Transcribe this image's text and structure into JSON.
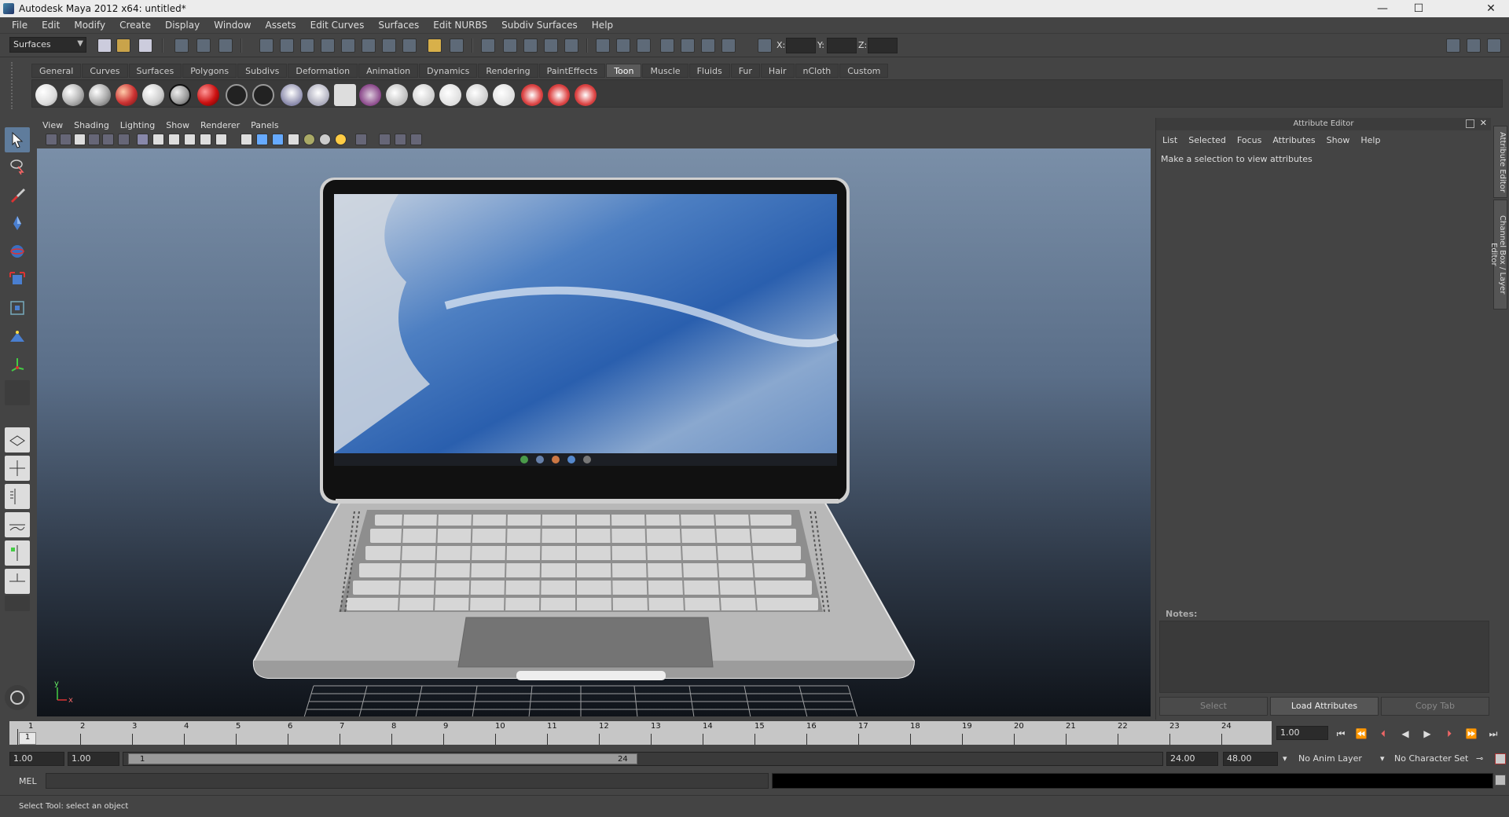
{
  "window": {
    "title": "Autodesk Maya 2012 x64: untitled*"
  },
  "menubar": [
    "File",
    "Edit",
    "Modify",
    "Create",
    "Display",
    "Window",
    "Assets",
    "Edit Curves",
    "Surfaces",
    "Edit NURBS",
    "Subdiv Surfaces",
    "Help"
  ],
  "statusline": {
    "mode": "Surfaces",
    "x_label": "X:",
    "y_label": "Y:",
    "z_label": "Z:"
  },
  "shelf": {
    "tabs": [
      "General",
      "Curves",
      "Surfaces",
      "Polygons",
      "Subdivs",
      "Deformation",
      "Animation",
      "Dynamics",
      "Rendering",
      "PaintEffects",
      "Toon",
      "Muscle",
      "Fluids",
      "Fur",
      "Hair",
      "nCloth",
      "Custom"
    ],
    "active_tab": "Toon"
  },
  "panel": {
    "menu": [
      "View",
      "Shading",
      "Lighting",
      "Show",
      "Renderer",
      "Panels"
    ],
    "axis_y": "y",
    "axis_x": "x"
  },
  "attribute_editor": {
    "header": "Attribute Editor",
    "menu": [
      "List",
      "Selected",
      "Focus",
      "Attributes",
      "Show",
      "Help"
    ],
    "message": "Make a selection to view attributes",
    "notes_label": "Notes:",
    "buttons": {
      "select": "Select",
      "load": "Load Attributes",
      "copy": "Copy Tab"
    },
    "side_tabs": {
      "ae": "Attribute Editor",
      "cb": "Channel Box / Layer Editor"
    }
  },
  "timeslider": {
    "ticks": [
      "1",
      "2",
      "3",
      "4",
      "5",
      "6",
      "7",
      "8",
      "9",
      "10",
      "11",
      "12",
      "13",
      "14",
      "15",
      "16",
      "17",
      "18",
      "19",
      "20",
      "21",
      "22",
      "23",
      "24"
    ],
    "current_marker": "1",
    "current_time": "1.00"
  },
  "range": {
    "start_time": "1.00",
    "playback_start": "1.00",
    "range_start": "1",
    "range_end": "24",
    "playback_end": "24.00",
    "end_time": "48.00",
    "anim_layer": "No Anim Layer",
    "character_set": "No Character Set"
  },
  "command_line": {
    "label": "MEL"
  },
  "help_line": {
    "text": "Select Tool: select an object"
  },
  "colors": {
    "bg": "#444444",
    "active_tab": "#5a5a5a",
    "tool_selected": "#5f7c9c",
    "viewport_top": "#7a8fa8",
    "viewport_bottom": "#0f1319"
  }
}
